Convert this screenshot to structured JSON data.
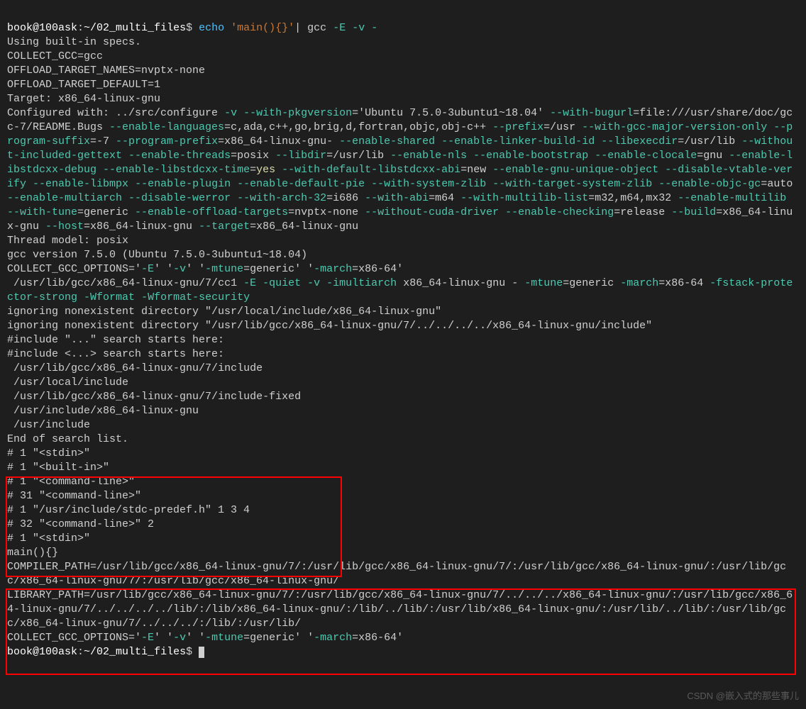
{
  "prompt1": {
    "user": "book@100ask",
    "sep": ":",
    "path": "~/02_multi_files",
    "end": "$"
  },
  "cmd1": {
    "echo": "echo",
    "arg": "'main(){}'",
    "pipe": "|",
    "gcc": " gcc ",
    "flags": "-E -v -"
  },
  "lines": {
    "l1": "Using built-in specs.",
    "l2": "COLLECT_GCC=gcc",
    "l3": "OFFLOAD_TARGET_NAMES=nvptx-none",
    "l4": "OFFLOAD_TARGET_DEFAULT=1",
    "l5": "Target: x86_64-linux-gnu",
    "cfg_a": "Configured with: ../src/configure ",
    "cfg_v": "-v",
    "cfg_b": " ",
    "cfg_pkgver_o": "--with-pkgversion",
    "cfg_pkgver_v": "='Ubuntu 7.5.0-3ubuntu1~18.04' ",
    "cfg_bugurl_o": "--with-bugurl",
    "cfg_bugurl_v": "=file:///usr/share/doc/gcc-7/README.Bugs ",
    "cfg_lang_o": "--enable-languages",
    "cfg_lang_v": "=c,ada,c++,go,brig,d,fortran,objc,obj-c++ ",
    "cfg_prefix_o": "--prefix",
    "cfg_prefix_v": "=/usr ",
    "cfg_maj_o": "--with-gcc-major-version-only",
    "cfg_sp1": " ",
    "cfg_psuf_o": "--program-suffix",
    "cfg_psuf_v": "=-7 ",
    "cfg_ppre_o": "--program-prefix",
    "cfg_ppre_v": "=x86_64-linux-gnu- ",
    "cfg_shared_o": "--enable-shared",
    "cfg_sp2": " ",
    "cfg_linker_o": "--enable-linker-build-id",
    "cfg_sp3": " ",
    "cfg_libexec_o": "--libexecdir",
    "cfg_libexec_v": "=/usr/lib ",
    "cfg_nogettext_o": "--without-included-gettext",
    "cfg_sp4": " ",
    "cfg_thr_o": "--enable-threads",
    "cfg_thr_v": "=posix ",
    "cfg_libdir_o": "--libdir",
    "cfg_libdir_v": "=/usr/lib ",
    "cfg_nls_o": "--enable-nls",
    "cfg_sp5": " ",
    "cfg_boot_o": "--enable-bootstrap",
    "cfg_sp6": " ",
    "cfg_cloc_o": "--enable-clocale",
    "cfg_cloc_v": "=gnu ",
    "cfg_libstd_o": "--enable-libstdcxx-debug",
    "cfg_sp7": " ",
    "cfg_libtime_o": "--enable-libstdcxx-time",
    "cfg_libtime_eq": "=",
    "cfg_libtime_v": "yes",
    "cfg_sp8": " ",
    "cfg_abi_o": "--with-default-libstdcxx-abi",
    "cfg_abi_v": "=new ",
    "cfg_uniq_o": "--enable-gnu-unique-object",
    "cfg_sp9": " ",
    "cfg_vtab_o": "--disable-vtable-verify",
    "cfg_sp10": " ",
    "cfg_mpx_o": "--enable-libmpx",
    "cfg_sp11": " ",
    "cfg_plugin_o": "--enable-plugin",
    "cfg_sp12": " ",
    "cfg_pie_o": "--enable-default-pie",
    "cfg_sp13": " ",
    "cfg_zlib_o": "--with-system-zlib",
    "cfg_sp14": " ",
    "cfg_tsz_o": "--with-target-system-zlib",
    "cfg_sp15": " ",
    "cfg_objcgc_o": "--enable-objc-gc",
    "cfg_objcgc_v": "=auto ",
    "cfg_multi_o": "--enable-multiarch",
    "cfg_sp16": " ",
    "cfg_werr_o": "--disable-werror",
    "cfg_sp17": " ",
    "cfg_arch32_o": "--with-arch-32",
    "cfg_arch32_v": "=i686 ",
    "cfg_abi2_o": "--with-abi",
    "cfg_abi2_v": "=m64 ",
    "cfg_mlist_o": "--with-multilib-list",
    "cfg_mlist_v": "=m32,m64,mx32 ",
    "cfg_mlib_o": "--enable-multilib",
    "cfg_sp18": " ",
    "cfg_tune_o": "--with-tune",
    "cfg_tune_v": "=generic ",
    "cfg_off_o": "--enable-offload-targets",
    "cfg_off_v": "=nvptx-none ",
    "cfg_cuda_o": "--without-cuda-driver",
    "cfg_sp19": " ",
    "cfg_chk_o": "--enable-checking",
    "cfg_chk_v": "=release ",
    "cfg_build_o": "--build",
    "cfg_build_v": "=x86_64-linux-gnu ",
    "cfg_host_o": "--host",
    "cfg_host_v": "=x86_64-linux-gnu ",
    "cfg_tgt_o": "--target",
    "cfg_tgt_v": "=x86_64-linux-gnu",
    "thread": "Thread model: posix",
    "gccver": "gcc version 7.5.0 (Ubuntu 7.5.0-3ubuntu1~18.04)",
    "opts1_a": "COLLECT_GCC_OPTIONS='",
    "opts1_e": "-E",
    "opts1_b": "' '",
    "opts1_v": "-v",
    "opts1_c": "' '",
    "opts1_mt": "-mtune",
    "opts1_d": "=generic' '",
    "opts1_ma": "-march",
    "opts1_f": "=x86-64'",
    "cc1_path": " /usr/lib/gcc/x86_64-linux-gnu/7/cc1 ",
    "cc1_E": "-E",
    "cc1_sp1": " ",
    "cc1_q": "-quiet",
    "cc1_sp2": " ",
    "cc1_v": "-v",
    "cc1_sp3": " ",
    "cc1_im": "-imultiarch",
    "cc1_imv": " x86_64-linux-gnu - ",
    "cc1_mt": "-mtune",
    "cc1_mtv": "=generic ",
    "cc1_ma": "-march",
    "cc1_mav": "=x86-64 ",
    "cc1_fs": "-fstack-protector-strong",
    "cc1_sp4": " ",
    "cc1_wf": "-Wformat",
    "cc1_sp5": " ",
    "cc1_wfs": "-Wformat-security",
    "ign1": "ignoring nonexistent directory \"/usr/local/include/x86_64-linux-gnu\"",
    "ign2": "ignoring nonexistent directory \"/usr/lib/gcc/x86_64-linux-gnu/7/../../../../x86_64-linux-gnu/include\"",
    "inc1": "#include \"...\" search starts here:",
    "inc2": "#include <...> search starts here:",
    "p1": " /usr/lib/gcc/x86_64-linux-gnu/7/include",
    "p2": " /usr/local/include",
    "p3": " /usr/lib/gcc/x86_64-linux-gnu/7/include-fixed",
    "p4": " /usr/include/x86_64-linux-gnu",
    "p5": " /usr/include",
    "endlist": "End of search list.",
    "pp1": "# 1 \"<stdin>\"",
    "pp2": "# 1 \"<built-in>\"",
    "pp3": "# 1 \"<command-line>\"",
    "pp4": "# 31 \"<command-line>\"",
    "pp5": "# 1 \"/usr/include/stdc-predef.h\" 1 3 4",
    "pp6": "# 32 \"<command-line>\" 2",
    "pp7": "# 1 \"<stdin>\"",
    "mainout": "main(){}",
    "cpath": "COMPILER_PATH=/usr/lib/gcc/x86_64-linux-gnu/7/:/usr/lib/gcc/x86_64-linux-gnu/7/:/usr/lib/gcc/x86_64-linux-gnu/:/usr/lib/gcc/x86_64-linux-gnu/7/:/usr/lib/gcc/x86_64-linux-gnu/",
    "lpath": "LIBRARY_PATH=/usr/lib/gcc/x86_64-linux-gnu/7/:/usr/lib/gcc/x86_64-linux-gnu/7/../../../x86_64-linux-gnu/:/usr/lib/gcc/x86_64-linux-gnu/7/../../../../lib/:/lib/x86_64-linux-gnu/:/lib/../lib/:/usr/lib/x86_64-linux-gnu/:/usr/lib/../lib/:/usr/lib/gcc/x86_64-linux-gnu/7/../../../:/lib/:/usr/lib/",
    "opts2_a": "COLLECT_GCC_OPTIONS='",
    "opts2_e": "-E",
    "opts2_b": "' '",
    "opts2_v": "-v",
    "opts2_c": "' '",
    "opts2_mt": "-mtune",
    "opts2_d": "=generic' '",
    "opts2_ma": "-march",
    "opts2_f": "=x86-64'"
  },
  "watermark": "CSDN @嵌入式的那些事儿"
}
